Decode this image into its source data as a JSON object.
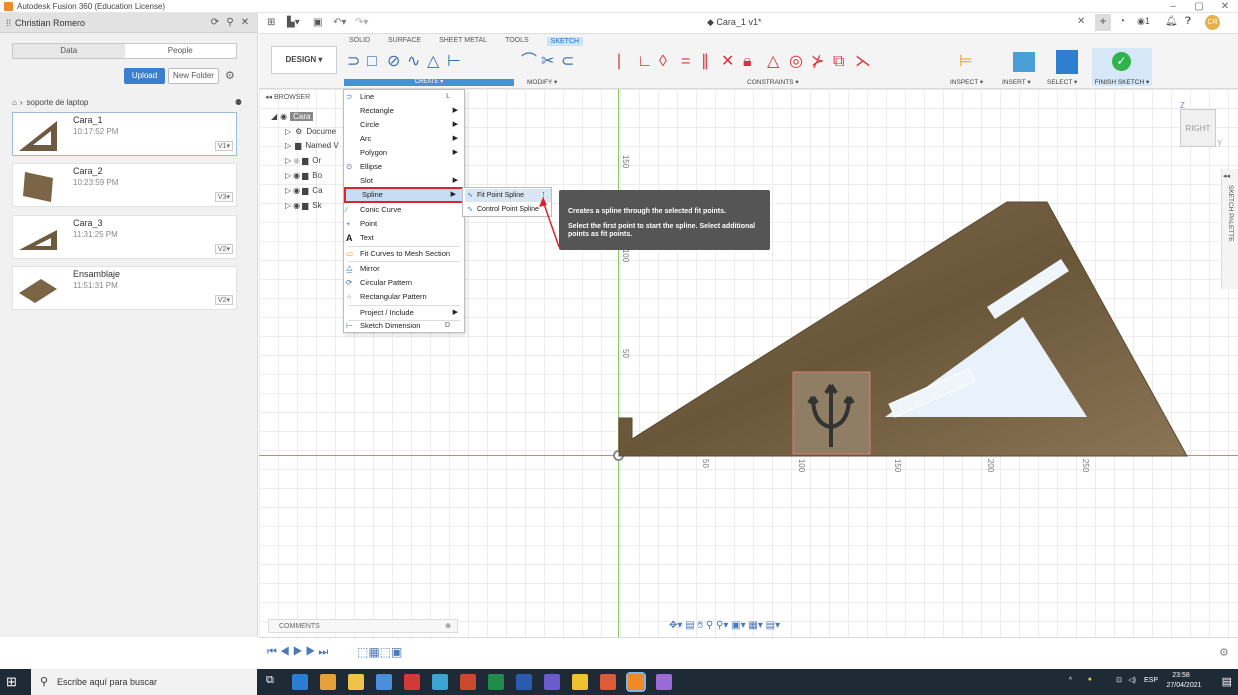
{
  "window": {
    "title": "Autodesk Fusion 360 (Education License)",
    "controls": [
      "–",
      "▢",
      "✕"
    ]
  },
  "left_panel": {
    "user": "Christian Romero",
    "tab_data": "Data",
    "tab_people": "People",
    "upload_label": "Upload",
    "new_folder_label": "New Folder",
    "breadcrumb": "soporte de laptop",
    "items": [
      {
        "name": "Cara_1",
        "time": "10:17:52 PM",
        "version": "V1▾"
      },
      {
        "name": "Cara_2",
        "time": "10:23:59 PM",
        "version": "V3▾"
      },
      {
        "name": "Cara_3",
        "time": "11:31:25 PM",
        "version": "V2▾"
      },
      {
        "name": "Ensamblaje",
        "time": "11:51:31 PM",
        "version": "V2▾"
      }
    ]
  },
  "document": {
    "tab_title": "Cara_1 v1*"
  },
  "toolbar": {
    "workspace": "DESIGN ▾",
    "tabs": [
      "SOLID",
      "SURFACE",
      "SHEET METAL",
      "TOOLS",
      "SKETCH"
    ],
    "groups": {
      "create": "CREATE ▾",
      "modify": "MODIFY ▾",
      "constraints": "CONSTRAINTS ▾",
      "inspect": "INSPECT ▾",
      "insert": "INSERT ▾",
      "select": "SELECT ▾",
      "finish": "FINISH SKETCH ▾"
    }
  },
  "browser": {
    "title": "BROWSER",
    "root": "Cara",
    "rows": [
      "Docume",
      "Named V",
      "Or",
      "Bo",
      "Ca",
      "Sk"
    ]
  },
  "create_menu": {
    "items": [
      {
        "label": "Line",
        "shortcut": "L",
        "arrow": ""
      },
      {
        "label": "Rectangle",
        "shortcut": "",
        "arrow": "▶"
      },
      {
        "label": "Circle",
        "shortcut": "",
        "arrow": "▶"
      },
      {
        "label": "Arc",
        "shortcut": "",
        "arrow": "▶"
      },
      {
        "label": "Polygon",
        "shortcut": "",
        "arrow": "▶"
      },
      {
        "label": "Ellipse",
        "shortcut": "",
        "arrow": ""
      },
      {
        "label": "Slot",
        "shortcut": "",
        "arrow": "▶"
      },
      {
        "label": "Spline",
        "shortcut": "",
        "arrow": "▶"
      },
      {
        "label": "Conic Curve",
        "shortcut": "",
        "arrow": ""
      },
      {
        "label": "Point",
        "shortcut": "",
        "arrow": ""
      },
      {
        "label": "Text",
        "shortcut": "",
        "arrow": ""
      },
      {
        "label": "Fit Curves to Mesh Section",
        "shortcut": "",
        "arrow": ""
      },
      {
        "label": "Mirror",
        "shortcut": "",
        "arrow": ""
      },
      {
        "label": "Circular Pattern",
        "shortcut": "",
        "arrow": ""
      },
      {
        "label": "Rectangular Pattern",
        "shortcut": "",
        "arrow": ""
      },
      {
        "label": "Project / Include",
        "shortcut": "",
        "arrow": "▶"
      },
      {
        "label": "Sketch Dimension",
        "shortcut": "D",
        "arrow": ""
      }
    ],
    "highlighted": "Spline"
  },
  "spline_submenu": {
    "items": [
      "Fit Point Spline",
      "Control Point Spline"
    ],
    "highlighted": "Fit Point Spline"
  },
  "tooltip": {
    "line1": "Creates a spline through the selected fit points.",
    "line2": "Select the first point to start the spline. Select additional points as fit points."
  },
  "viewport": {
    "axis_labels_x": [
      "50",
      "100",
      "150",
      "200",
      "250"
    ],
    "axis_labels_y": [
      "150",
      "100",
      "50"
    ],
    "viewcube_label": "RIGHT",
    "sketch_palette": "SKETCH PALETTE"
  },
  "comments_label": "COMMENTS",
  "taskbar": {
    "search_placeholder": "Escribe aquí para buscar",
    "language": "ESP",
    "time": "23:58",
    "date": "27/04/2021"
  }
}
